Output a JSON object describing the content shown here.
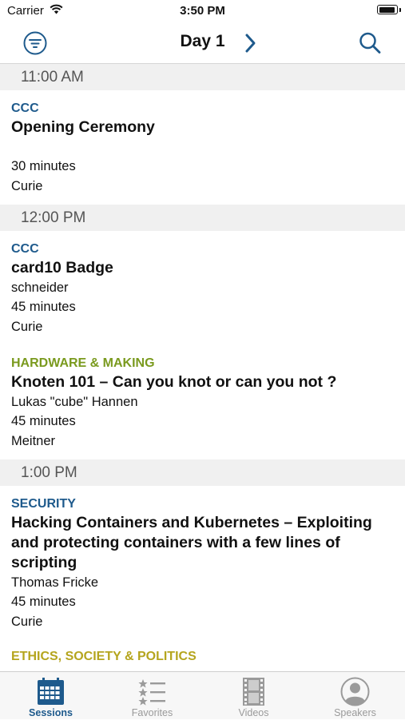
{
  "status_bar": {
    "carrier": "Carrier",
    "time": "3:50 PM"
  },
  "nav": {
    "title": "Day 1"
  },
  "colors": {
    "accent": "#1e5a8c",
    "track_ccc": "#1e5a8c",
    "track_security": "#1e5a8c",
    "track_hardware": "#7a9a1e",
    "track_ethics": "#b5a51e"
  },
  "sections": [
    {
      "time": "11:00 AM",
      "sessions": [
        {
          "track": "CCC",
          "track_color": "#1e5a8c",
          "title": "Opening Ceremony",
          "speaker": "",
          "duration": "30 minutes",
          "room": "Curie"
        }
      ]
    },
    {
      "time": "12:00 PM",
      "sessions": [
        {
          "track": "CCC",
          "track_color": "#1e5a8c",
          "title": "card10 Badge",
          "speaker": "schneider",
          "duration": "45 minutes",
          "room": "Curie"
        },
        {
          "track": "HARDWARE & MAKING",
          "track_color": "#7a9a1e",
          "title": "Knoten 101 – Can you knot or can you not ?",
          "speaker": "Lukas \"cube\" Hannen",
          "duration": "45 minutes",
          "room": "Meitner"
        }
      ]
    },
    {
      "time": "1:00 PM",
      "sessions": [
        {
          "track": "SECURITY",
          "track_color": "#1e5a8c",
          "title": "Hacking Containers and Kubernetes – Exploiting and protecting containers with a few lines of scripting",
          "speaker": "Thomas Fricke",
          "duration": "45 minutes",
          "room": "Curie"
        },
        {
          "track": "ETHICS, SOCIETY & POLITICS",
          "track_color": "#b5a51e",
          "title": "",
          "speaker": "",
          "duration": "",
          "room": ""
        }
      ]
    }
  ],
  "tabs": [
    {
      "label": "Sessions",
      "icon": "calendar-icon",
      "active": true
    },
    {
      "label": "Favorites",
      "icon": "star-list-icon",
      "active": false
    },
    {
      "label": "Videos",
      "icon": "film-icon",
      "active": false
    },
    {
      "label": "Speakers",
      "icon": "person-icon",
      "active": false
    }
  ]
}
